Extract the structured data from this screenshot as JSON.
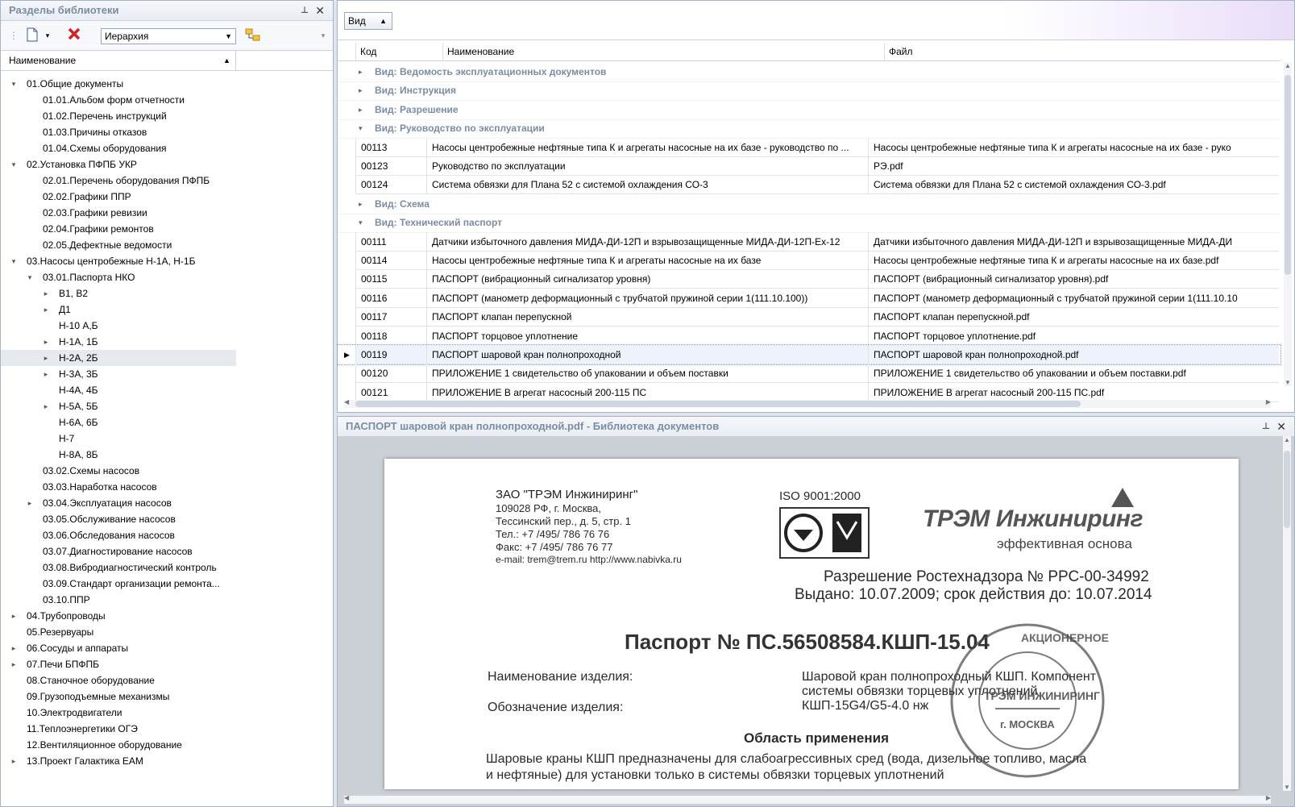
{
  "left_panel": {
    "title": "Разделы библиотеки",
    "pin": "⊥",
    "close": "✕",
    "view_combo": "Иерархия",
    "column_header": "Наименование",
    "tree": [
      {
        "label": "01.Общие документы",
        "level": 0,
        "exp": "▾"
      },
      {
        "label": "01.01.Альбом форм отчетности",
        "level": 1,
        "exp": ""
      },
      {
        "label": "01.02.Перечень инструкций",
        "level": 1,
        "exp": ""
      },
      {
        "label": "01.03.Причины отказов",
        "level": 1,
        "exp": ""
      },
      {
        "label": "01.04.Схемы оборудования",
        "level": 1,
        "exp": ""
      },
      {
        "label": "02.Установка ПФПБ УКР",
        "level": 0,
        "exp": "▾"
      },
      {
        "label": "02.01.Перечень оборудования ПФПБ",
        "level": 1,
        "exp": ""
      },
      {
        "label": "02.02.Графики ППР",
        "level": 1,
        "exp": ""
      },
      {
        "label": "02.03.Графики ревизии",
        "level": 1,
        "exp": ""
      },
      {
        "label": "02.04.Графики ремонтов",
        "level": 1,
        "exp": ""
      },
      {
        "label": "02.05.Дефектные ведомости",
        "level": 1,
        "exp": ""
      },
      {
        "label": "03.Насосы центробежные Н-1А, Н-1Б",
        "level": 0,
        "exp": "▾"
      },
      {
        "label": "03.01.Паспорта НКО",
        "level": 1,
        "exp": "▾"
      },
      {
        "label": "В1, В2",
        "level": 2,
        "exp": "▸"
      },
      {
        "label": "Д1",
        "level": 2,
        "exp": "▸"
      },
      {
        "label": "Н-10 А,Б",
        "level": 2,
        "exp": ""
      },
      {
        "label": "Н-1А, 1Б",
        "level": 2,
        "exp": "▸"
      },
      {
        "label": "Н-2А, 2Б",
        "level": 2,
        "exp": "▸",
        "selected": true
      },
      {
        "label": "Н-3А, 3Б",
        "level": 2,
        "exp": "▸"
      },
      {
        "label": "Н-4А, 4Б",
        "level": 2,
        "exp": ""
      },
      {
        "label": "Н-5А, 5Б",
        "level": 2,
        "exp": "▸"
      },
      {
        "label": "Н-6А, 6Б",
        "level": 2,
        "exp": ""
      },
      {
        "label": "Н-7",
        "level": 2,
        "exp": ""
      },
      {
        "label": "Н-8А, 8Б",
        "level": 2,
        "exp": ""
      },
      {
        "label": "03.02.Схемы насосов",
        "level": 1,
        "exp": ""
      },
      {
        "label": "03.03.Наработка насосов",
        "level": 1,
        "exp": ""
      },
      {
        "label": "03.04.Эксплуатация насосов",
        "level": 1,
        "exp": "▸"
      },
      {
        "label": "03.05.Обслуживание насосов",
        "level": 1,
        "exp": ""
      },
      {
        "label": "03.06.Обследования насосов",
        "level": 1,
        "exp": ""
      },
      {
        "label": "03.07.Диагностирование насосов",
        "level": 1,
        "exp": ""
      },
      {
        "label": "03.08.Вибродиагностический контроль",
        "level": 1,
        "exp": ""
      },
      {
        "label": "03.09.Стандарт организации ремонта...",
        "level": 1,
        "exp": ""
      },
      {
        "label": "03.10.ППР",
        "level": 1,
        "exp": ""
      },
      {
        "label": "04.Трубопроводы",
        "level": 0,
        "exp": "▸"
      },
      {
        "label": "05.Резервуары",
        "level": 0,
        "exp": ""
      },
      {
        "label": "06.Сосуды и аппараты",
        "level": 0,
        "exp": "▸"
      },
      {
        "label": "07.Печи БПФПБ",
        "level": 0,
        "exp": "▸"
      },
      {
        "label": "08.Станочное оборудование",
        "level": 0,
        "exp": ""
      },
      {
        "label": "09.Грузоподъемные механизмы",
        "level": 0,
        "exp": ""
      },
      {
        "label": "10.Электродвигатели",
        "level": 0,
        "exp": ""
      },
      {
        "label": "11.Теплоэнергетики ОГЭ",
        "level": 0,
        "exp": ""
      },
      {
        "label": "12.Вентиляционное оборудование",
        "level": 0,
        "exp": ""
      },
      {
        "label": "13.Проект Галактика ЕАМ",
        "level": 0,
        "exp": "▸"
      }
    ]
  },
  "grid": {
    "view_button": "Вид",
    "columns": {
      "code": "Код",
      "name": "Наименование",
      "file": "Файл"
    },
    "rows": [
      {
        "type": "group",
        "label": "Вид: Ведомость эксплуатационных документов",
        "exp": "▸"
      },
      {
        "type": "group",
        "label": "Вид: Инструкция",
        "exp": "▸"
      },
      {
        "type": "group",
        "label": "Вид: Разрешение",
        "exp": "▸"
      },
      {
        "type": "group",
        "label": "Вид: Руководство по эксплуатации",
        "exp": "▾"
      },
      {
        "type": "data",
        "code": "00113",
        "name": "Насосы центробежные нефтяные типа К и агрегаты насосные на их базе - руководство по ...",
        "file": "Насосы центробежные нефтяные типа К и агрегаты насосные на их базе - руко"
      },
      {
        "type": "data",
        "code": "00123",
        "name": "Руководство по эксплуатации",
        "file": "РЭ.pdf"
      },
      {
        "type": "data",
        "code": "00124",
        "name": "Система обвязки для Плана 52 с системой охлаждения СО-3",
        "file": "Система обвязки для Плана 52 с системой охлаждения СО-3.pdf"
      },
      {
        "type": "group",
        "label": "Вид: Схема",
        "exp": "▸"
      },
      {
        "type": "group",
        "label": "Вид: Технический паспорт",
        "exp": "▾"
      },
      {
        "type": "data",
        "code": "00111",
        "name": "Датчики избыточного давления МИДА-ДИ-12П и взрывозащищенные МИДА-ДИ-12П-Ех-12",
        "file": "Датчики избыточного давления МИДА-ДИ-12П и взрывозащищенные МИДА-ДИ"
      },
      {
        "type": "data",
        "code": "00114",
        "name": "Насосы центробежные нефтяные типа К и агрегаты насосные на их базе",
        "file": "Насосы центробежные нефтяные типа К и агрегаты насосные на их базе.pdf"
      },
      {
        "type": "data",
        "code": "00115",
        "name": "ПАСПОРТ (вибрационный сигнализатор уровня)",
        "file": "ПАСПОРТ (вибрационный сигнализатор уровня).pdf"
      },
      {
        "type": "data",
        "code": "00116",
        "name": "ПАСПОРТ (манометр деформационный с трубчатой пружиной серии 1(111.10.100))",
        "file": "ПАСПОРТ (манометр деформационный с трубчатой пружиной серии 1(111.10.10"
      },
      {
        "type": "data",
        "code": "00117",
        "name": "ПАСПОРТ клапан перепускной",
        "file": "ПАСПОРТ клапан перепускной.pdf"
      },
      {
        "type": "data",
        "code": "00118",
        "name": "ПАСПОРТ торцовое уплотнение",
        "file": "ПАСПОРТ торцовое уплотнение.pdf"
      },
      {
        "type": "data",
        "code": "00119",
        "name": "ПАСПОРТ шаровой кран полнопроходной",
        "file": "ПАСПОРТ шаровой кран полнопроходной.pdf",
        "selected": true
      },
      {
        "type": "data",
        "code": "00120",
        "name": "ПРИЛОЖЕНИЕ 1 свидетельство об упаковании и объем поставки",
        "file": "ПРИЛОЖЕНИЕ 1 свидетельство об упаковании и объем поставки.pdf"
      },
      {
        "type": "data",
        "code": "00121",
        "name": "ПРИЛОЖЕНИЕ В агрегат насосный 200-115 ПС",
        "file": "ПРИЛОЖЕНИЕ В агрегат насосный 200-115 ПС.pdf"
      }
    ]
  },
  "viewer": {
    "title": "ПАСПОРТ шаровой кран полнопроходной.pdf - Библиотека документов",
    "doc": {
      "company": "ЗАО \"ТРЭМ Инжиниринг\"",
      "addr1": "109028 РФ, г. Москва,",
      "addr2": "Тессинский пер., д. 5, стр. 1",
      "tel": "Тел.: +7 /495/ 786 76 76",
      "fax": "Факс: +7 /495/ 786 76 77",
      "email": "e-mail: trem@trem.ru http://www.nabivka.ru",
      "iso": "ISO 9001:2000",
      "logo": "ТРЭМ Инжиниринг",
      "slogan": "эффективная основа",
      "permit": "Разрешение Ростехнадзора № РРС-00-34992",
      "issued": "Выдано: 10.07.2009; срок действия до: 10.07.2014",
      "passport": "Паспорт № ПС.56508584.КШП-15.04",
      "product_label": "Наименование изделия:",
      "product_value1": "Шаровой кран полнопроходный КШП. Компонент",
      "product_value2": "системы обвязки торцевых уплотнений",
      "designation_label": "Обозначение изделия:",
      "designation_value": "КШП-15G4/G5-4.0 нж",
      "section": "Область применения",
      "body1": "Шаровые краны КШП предназначены для слабоагрессивных сред (вода, дизельное топливо, масла",
      "body2": "и нефтяные) для установки только в системы обвязки торцевых уплотнений",
      "stamp_top": "АКЦИОНЕРНОЕ",
      "stamp_mid": "ТРЭМ ИНЖИНИРИНГ",
      "stamp_city": "г. МОСКВА"
    }
  }
}
